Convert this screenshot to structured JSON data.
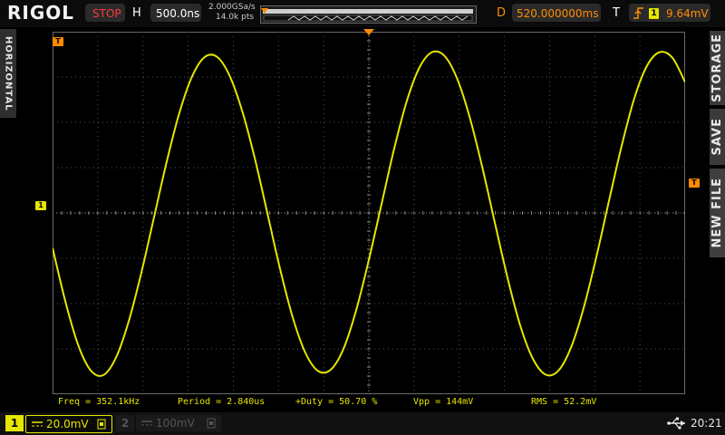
{
  "brand": "RIGOL",
  "status": {
    "run_state": "STOP"
  },
  "horizontal": {
    "label": "H",
    "time_base": "500.0ns",
    "sample_rate": "2.000GSa/s",
    "memory_depth": "14.0k pts"
  },
  "delay": {
    "label": "D",
    "value": "520.000000ms"
  },
  "trigger": {
    "label": "T",
    "source_channel": "1",
    "level": "9.64mV"
  },
  "side_tabs": {
    "left": "HORIZONTAL",
    "right": [
      "STORAGE",
      "SAVE",
      "NEW FILE"
    ]
  },
  "markers": {
    "trigger_position": "T",
    "channel": "1"
  },
  "measurements": {
    "freq": "Freq = 352.1kHz",
    "period": "Period = 2.840us",
    "duty": "+Duty = 50.70 %",
    "vpp": "Vpp = 144mV",
    "rms": "RMS = 52.2mV"
  },
  "channels": [
    {
      "number": "1",
      "coupling": "DC",
      "scale": "20.0mV",
      "active": true
    },
    {
      "number": "2",
      "coupling": "DC",
      "scale": "100mV",
      "active": false
    }
  ],
  "system": {
    "usb": "usb-icon",
    "time": "20:21"
  },
  "colors": {
    "ch1": "#e6e600",
    "trigger": "#ff8c00",
    "stop": "#ff3a3a",
    "grid": "#555555"
  },
  "chart_data": {
    "type": "line",
    "title": "",
    "xlabel": "",
    "ylabel": "",
    "x_unit": "us",
    "y_unit": "mV",
    "x_range": [
      -2.5,
      2.5
    ],
    "y_range": [
      -80,
      80
    ],
    "series": [
      {
        "x": [
          -2.5,
          -2.4,
          -2.3,
          -2.2,
          -2.1,
          -2.0,
          -1.9,
          -1.8,
          -1.7,
          -1.6,
          -1.5,
          -1.4,
          -1.3,
          -1.2,
          -1.1,
          -1.0,
          -0.9,
          -0.8,
          -0.7,
          -0.6,
          -0.5,
          -0.4,
          -0.3,
          -0.2,
          -0.1,
          0.0,
          0.1,
          0.2,
          0.3,
          0.4,
          0.5,
          0.6,
          0.7,
          0.8,
          0.9,
          1.0,
          1.1,
          1.2,
          1.3,
          1.4,
          1.5,
          1.6,
          1.7,
          1.8,
          1.9,
          2.0,
          2.1,
          2.2,
          2.3,
          2.4,
          2.5
        ],
        "y": [
          -15.4,
          -38.8,
          -57.9,
          -69.4,
          -71.6,
          -64.0,
          -48.2,
          -26.8,
          -2.4,
          22.1,
          43.7,
          59.9,
          68.7,
          68.9,
          60.5,
          44.8,
          23.8,
          -0.6,
          -25.1,
          -46.4,
          -61.9,
          -69.8,
          -69.1,
          -59.9,
          -42.9,
          -20.7,
          3.8,
          28.3,
          49.4,
          64.2,
          71.0,
          69.2,
          59.0,
          41.7,
          19.4,
          -5.3,
          -29.5,
          -50.3,
          -64.7,
          -71.4,
          -69.5,
          -59.1,
          -41.5,
          -19.0,
          5.8,
          30.0,
          50.9,
          65.1,
          71.0,
          68.5,
          57.7
        ]
      }
    ]
  }
}
